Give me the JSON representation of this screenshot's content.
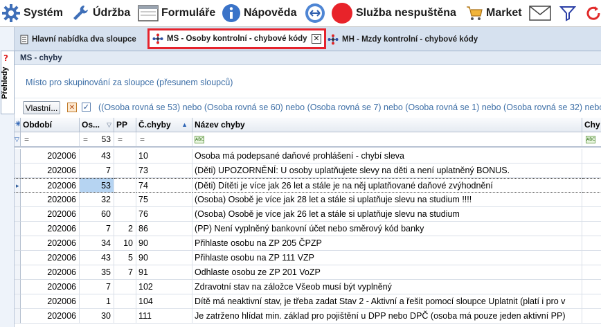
{
  "menu": {
    "items": [
      {
        "id": "system",
        "label": "Systém",
        "icon": "gear-icon"
      },
      {
        "id": "udrzba",
        "label": "Údržba",
        "icon": "wrench-icon"
      },
      {
        "id": "formulare",
        "label": "Formuláře",
        "icon": "window-icon"
      },
      {
        "id": "napoveda",
        "label": "Nápověda",
        "icon": "info-icon"
      },
      {
        "id": "sync",
        "label": "",
        "icon": "sync-arrows-icon"
      },
      {
        "id": "sluzba",
        "label": "Služba nespuštěna",
        "icon": "red-status-icon"
      },
      {
        "id": "market",
        "label": "Market",
        "icon": "cart-icon"
      },
      {
        "id": "mail",
        "label": "",
        "icon": "mail-icon"
      },
      {
        "id": "filter",
        "label": "",
        "icon": "funnel-icon"
      },
      {
        "id": "refresh",
        "label": "",
        "icon": "refresh-icon"
      }
    ]
  },
  "side": {
    "tab_label": "Přehledy",
    "icon": "help-icon"
  },
  "tabs": [
    {
      "label": "Hlavní nabídka dva sloupce",
      "icon": "document-icon",
      "active": false
    },
    {
      "label": "MS - Osoby kontrolní - chybové kódy",
      "icon": "network-icon",
      "active": true,
      "close": "✕"
    },
    {
      "label": "MH - Mzdy kontrolní - chybové kódy",
      "icon": "network-icon",
      "active": false
    }
  ],
  "panel": {
    "title": "MS - chyby"
  },
  "grouping": {
    "hint": "Místo pro skupinování za sloupce (přesunem sloupců)"
  },
  "filterbar": {
    "custom_label": "Vlastní...",
    "clear_glyph": "✕",
    "check_glyph": "✓",
    "expression": "((Osoba rovná se 53) nebo (Osoba rovná se 60) nebo (Osoba rovná se 7) nebo (Osoba rovná se 1) nebo (Osoba rovná se 32) nebo"
  },
  "grid": {
    "columns": [
      {
        "key": "period",
        "label": "Období"
      },
      {
        "key": "person",
        "label": "Os..."
      },
      {
        "key": "pp",
        "label": "PP"
      },
      {
        "key": "code",
        "label": "Č.chyby",
        "sort": "▲"
      },
      {
        "key": "name",
        "label": "Název chyby"
      },
      {
        "key": "extra",
        "label": "Chy"
      }
    ],
    "filter_row": {
      "eq": "=",
      "person_value": "53",
      "abc": "ABC"
    },
    "rows": [
      {
        "period": "202006",
        "person": "43",
        "pp": "",
        "code": "10",
        "name": "Osoba má podepsané daňové prohlášení - chybí sleva"
      },
      {
        "period": "202006",
        "person": "7",
        "pp": "",
        "code": "73",
        "name": "(Děti) UPOZORNĚNÍ: U osoby uplatňujete slevy na děti a není uplatněný BONUS."
      },
      {
        "period": "202006",
        "person": "53",
        "pp": "",
        "code": "74",
        "name": "(Děti) Dítěti je více jak 26 let a stále je na něj uplatňované daňové zvýhodnění"
      },
      {
        "period": "202006",
        "person": "32",
        "pp": "",
        "code": "75",
        "name": "(Osoba) Osobě je více jak 28 let a stále si uplatňuje slevu na studium !!!!"
      },
      {
        "period": "202006",
        "person": "60",
        "pp": "",
        "code": "76",
        "name": "(Osoba) Osobě je více jak 26 let a stále si uplatňuje slevu na studium"
      },
      {
        "period": "202006",
        "person": "7",
        "pp": "2",
        "code": "86",
        "name": "(PP) Není vyplněný bankovní účet nebo směrový kód banky"
      },
      {
        "period": "202006",
        "person": "34",
        "pp": "10",
        "code": "90",
        "name": "Přihlaste osobu na ZP 205 ČPZP"
      },
      {
        "period": "202006",
        "person": "43",
        "pp": "5",
        "code": "90",
        "name": "Přihlaste osobu na ZP 111 VZP"
      },
      {
        "period": "202006",
        "person": "35",
        "pp": "7",
        "code": "91",
        "name": "Odhlaste osobu ze ZP 201 VoZP"
      },
      {
        "period": "202006",
        "person": "7",
        "pp": "",
        "code": "102",
        "name": "Zdravotní stav na záložce Všeob musí být vyplněný"
      },
      {
        "period": "202006",
        "person": "1",
        "pp": "",
        "code": "104",
        "name": "Dítě má neaktivní stav, je třeba zadat Stav 2 - Aktivní a řešit pomocí sloupce Uplatnit (platí i pro v"
      },
      {
        "period": "202006",
        "person": "30",
        "pp": "",
        "code": "111",
        "name": "Je zatrženo hlídat min. základ pro pojištění u DPP nebo DPČ (osoba má pouze jeden aktivní PP)"
      }
    ],
    "active_row": 2
  },
  "colors": {
    "accent": "#e5232d",
    "link_text": "#3c6ea6",
    "selection": "#b6d4f2"
  }
}
